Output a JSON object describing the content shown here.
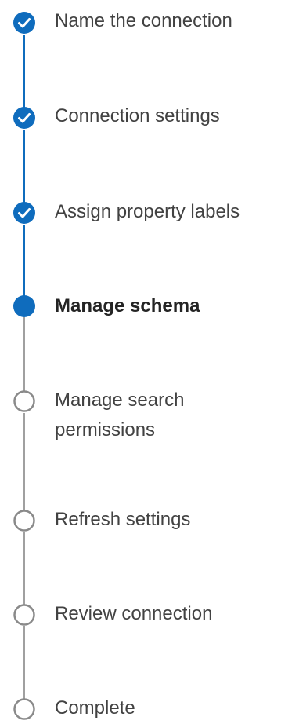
{
  "colors": {
    "accent": "#0f6cbd",
    "pending": "#8a8a8a",
    "connector_pending": "#a0a0a0",
    "text": "#424242"
  },
  "steps": [
    {
      "label": "Name the connection",
      "status": "completed",
      "icon": "checkmark-circle-icon"
    },
    {
      "label": "Connection settings",
      "status": "completed",
      "icon": "checkmark-circle-icon"
    },
    {
      "label": "Assign property labels",
      "status": "completed",
      "icon": "checkmark-circle-icon"
    },
    {
      "label": "Manage schema",
      "status": "current",
      "icon": "filled-circle-icon"
    },
    {
      "label_line1": "Manage search",
      "label_line2": "permissions",
      "status": "pending",
      "icon": "empty-circle-icon"
    },
    {
      "label": "Refresh settings",
      "status": "pending",
      "icon": "empty-circle-icon"
    },
    {
      "label": "Review connection",
      "status": "pending",
      "icon": "empty-circle-icon"
    },
    {
      "label": "Complete",
      "status": "pending",
      "icon": "empty-circle-icon"
    }
  ]
}
